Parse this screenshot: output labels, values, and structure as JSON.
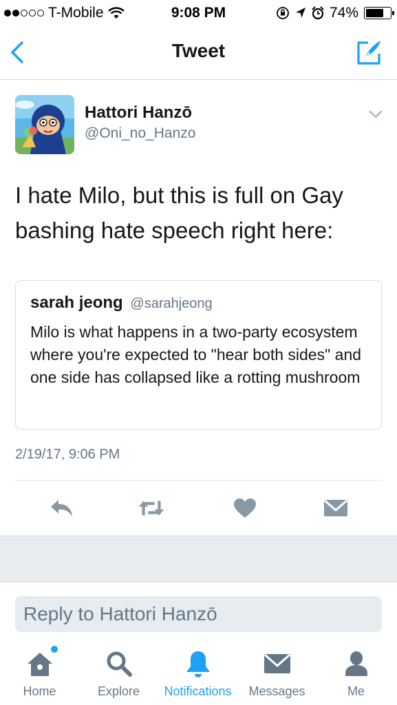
{
  "status_bar": {
    "carrier": "T-Mobile",
    "time": "9:08 PM",
    "battery": "74%",
    "battery_level": 0.74
  },
  "nav": {
    "title": "Tweet",
    "back_icon": "chevron-left-icon",
    "compose_icon": "compose-icon"
  },
  "tweet": {
    "author_name": "Hattori Hanzō",
    "author_handle": "@Oni_no_Hanzo",
    "text": "I hate Milo, but this is full on Gay bashing hate speech right here:",
    "timestamp": "2/19/17, 9:06 PM"
  },
  "quote": {
    "author_name": "sarah jeong",
    "author_handle": "@sarahjeong",
    "text": "Milo is what happens in a two-party ecosystem where you're expected to \"hear both sides\" and one side has collapsed like a rotting mushroom"
  },
  "reply": {
    "placeholder": "Reply to Hattori Hanzō"
  },
  "tabs": [
    {
      "label": "Home",
      "icon": "home-icon"
    },
    {
      "label": "Explore",
      "icon": "search-icon"
    },
    {
      "label": "Notifications",
      "icon": "bell-icon"
    },
    {
      "label": "Messages",
      "icon": "envelope-icon"
    },
    {
      "label": "Me",
      "icon": "person-icon"
    }
  ],
  "colors": {
    "accent": "#1da1f2",
    "icon_gray": "#657786",
    "action_gray": "#8899a6"
  }
}
